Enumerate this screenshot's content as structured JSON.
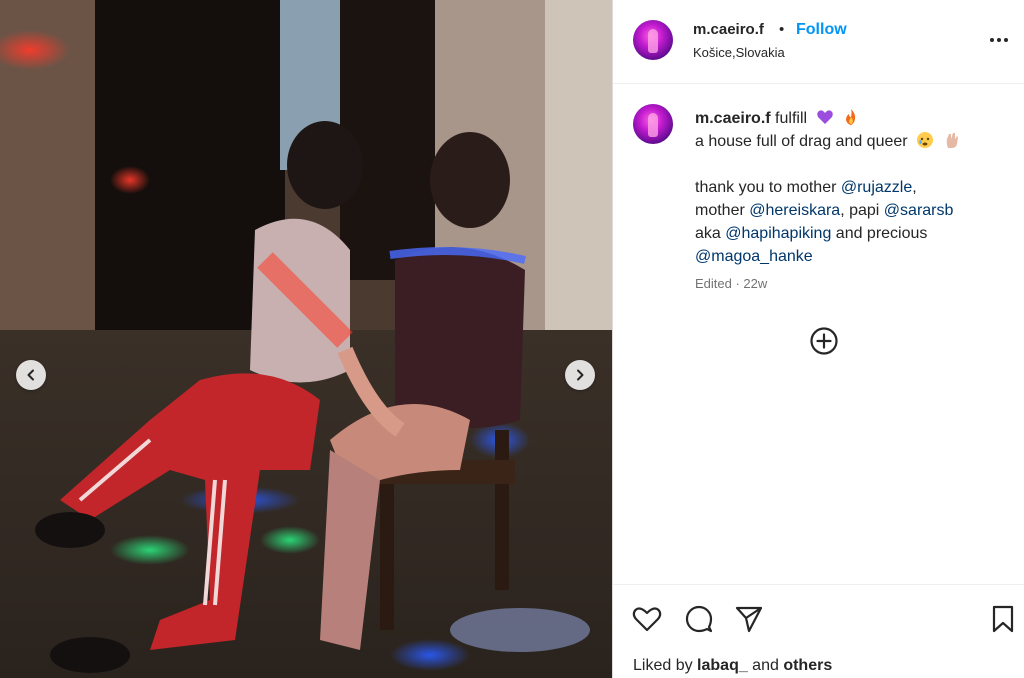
{
  "header": {
    "username": "m.caeiro.f",
    "separator": "•",
    "follow_label": "Follow",
    "location": "Košice,Slovakia"
  },
  "caption": {
    "username": "m.caeiro.f",
    "line1_text": "fulfill",
    "line2_text": "a house full of drag and queer",
    "line3_pre": "thank you to mother ",
    "mention1": "@rujazzle",
    "line3_post": ",",
    "line4_pre": "mother ",
    "mention2": "@hereiskara",
    "line4_mid": ", papi ",
    "mention3": "@sararsb",
    "line5_pre": "aka ",
    "mention4": "@hapihapiking",
    "line5_post": " and precious",
    "mention5": "@magoa_hanke",
    "meta": "Edited · 22w"
  },
  "likes": {
    "prefix": "Liked by ",
    "user": "labaq_",
    "middle": " and ",
    "others": "others"
  },
  "colors": {
    "follow": "#0095f6",
    "mention": "#00376b",
    "muted": "#737373"
  },
  "icons": [
    "chevron-left-icon",
    "chevron-right-icon",
    "more-options-icon",
    "purple-heart-emoji",
    "fire-emoji",
    "crying-face-emoji",
    "hand-emoji",
    "add-circle-icon",
    "heart-icon",
    "comment-icon",
    "share-icon",
    "bookmark-icon"
  ]
}
